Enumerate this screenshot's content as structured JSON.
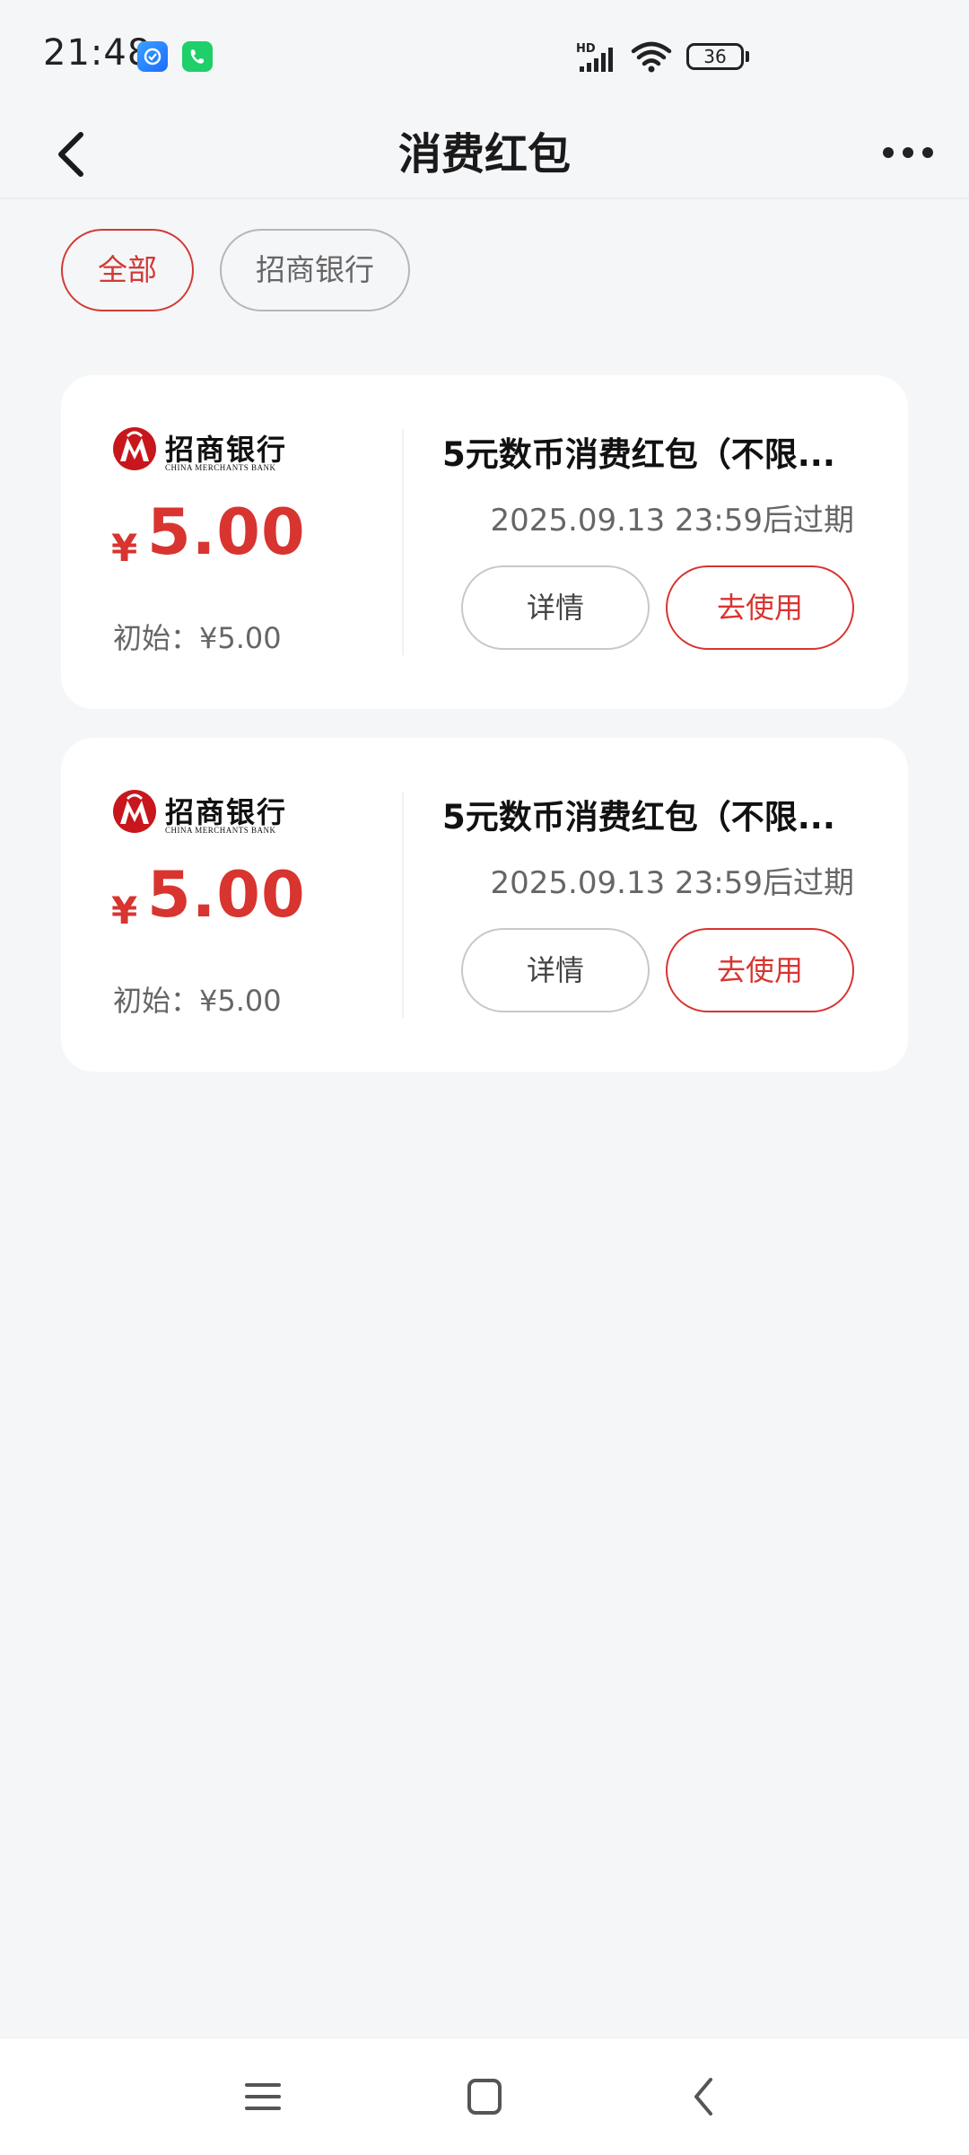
{
  "status_bar": {
    "time": "21:48",
    "network": "HD",
    "battery": "36"
  },
  "header": {
    "title": "消费红包"
  },
  "filters": [
    {
      "label": "全部",
      "selected": true
    },
    {
      "label": "招商银行",
      "selected": false
    }
  ],
  "colors": {
    "accent_red": "#d83430",
    "background": "#f5f6f8",
    "card": "#ffffff"
  },
  "coupons": [
    {
      "bank_name_cn": "招商银行",
      "bank_name_en": "CHINA MERCHANTS BANK",
      "currency": "¥",
      "amount": "5.00",
      "initial": "初始：¥5.00",
      "title": "5元数币消费红包（不限...",
      "expiry": "2025.09.13 23:59后过期",
      "detail_label": "详情",
      "use_label": "去使用"
    },
    {
      "bank_name_cn": "招商银行",
      "bank_name_en": "CHINA MERCHANTS BANK",
      "currency": "¥",
      "amount": "5.00",
      "initial": "初始：¥5.00",
      "title": "5元数币消费红包（不限...",
      "expiry": "2025.09.13 23:59后过期",
      "detail_label": "详情",
      "use_label": "去使用"
    }
  ],
  "icons": {
    "back": "chevron-left-icon",
    "more": "more-horizontal-icon",
    "nav_menu": "menu-icon",
    "nav_home": "home-square-icon",
    "nav_back": "back-icon"
  }
}
